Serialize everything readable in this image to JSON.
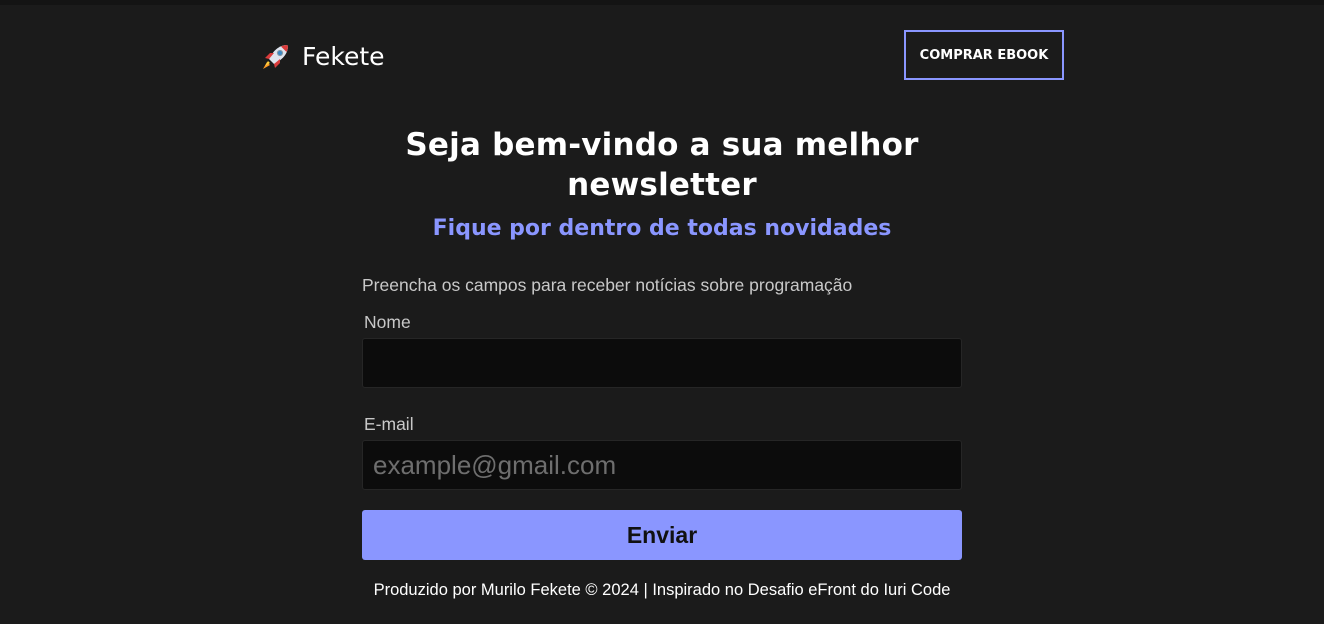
{
  "header": {
    "brand_icon": "rocket-icon",
    "brand_name": "Fekete",
    "cta_label": "COMPRAR EBOOK"
  },
  "hero": {
    "title": "Seja bem-vindo a sua melhor newsletter",
    "subtitle": "Fique por dentro de todas novidades"
  },
  "form": {
    "intro": "Preencha os campos para receber notícias sobre programação",
    "name_label": "Nome",
    "name_value": "",
    "name_placeholder": "",
    "email_label": "E-mail",
    "email_value": "",
    "email_placeholder": "example@gmail.com",
    "submit_label": "Enviar"
  },
  "footer": {
    "text": "Produzido por Murilo Fekete © 2024 | Inspirado no Desafio eFront do Iuri Code"
  },
  "colors": {
    "background": "#1b1b1b",
    "accent": "#8a96ff",
    "input_background": "#0c0c0c",
    "text_primary": "#ffffff",
    "text_secondary": "#c8c8c8"
  }
}
